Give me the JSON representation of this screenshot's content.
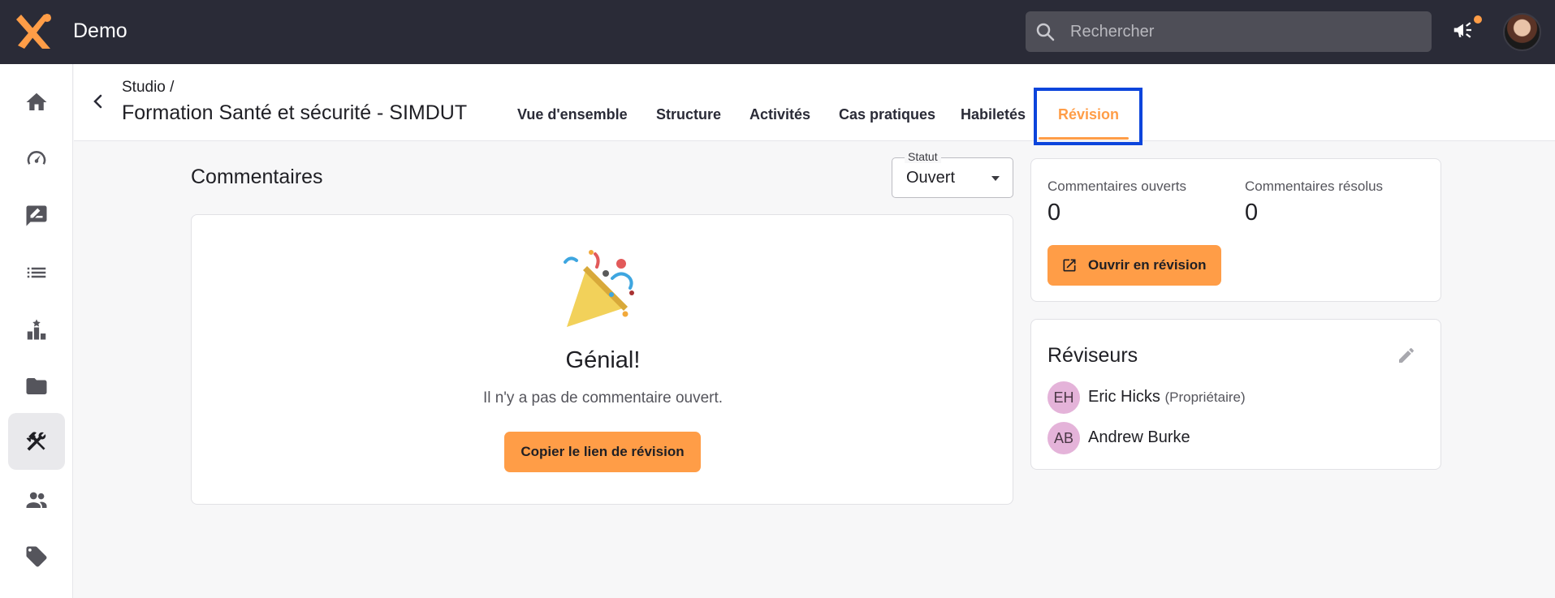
{
  "app": {
    "title": "Demo"
  },
  "search": {
    "placeholder": "Rechercher"
  },
  "colors": {
    "accent": "#ff9d47",
    "topbar": "#2a2b37",
    "highlight": "#0c45dc"
  },
  "sidebar": {
    "items": [
      {
        "icon": "home-icon"
      },
      {
        "icon": "dashboard-gauge-icon"
      },
      {
        "icon": "rate-review-icon"
      },
      {
        "icon": "list-icon"
      },
      {
        "icon": "leaderboard-icon"
      },
      {
        "icon": "folder-icon"
      },
      {
        "icon": "tools-icon",
        "active": true
      },
      {
        "icon": "people-icon"
      },
      {
        "icon": "tag-icon"
      }
    ]
  },
  "header": {
    "breadcrumb": "Studio /",
    "title": "Formation Santé et sécurité - SIMDUT",
    "tabs": [
      {
        "label": "Vue d'ensemble"
      },
      {
        "label": "Structure"
      },
      {
        "label": "Activités"
      },
      {
        "label": "Cas pratiques"
      },
      {
        "label": "Habiletés"
      },
      {
        "label": "Révision",
        "active": true
      }
    ]
  },
  "comments": {
    "title": "Commentaires",
    "status": {
      "legend": "Statut",
      "value": "Ouvert"
    },
    "empty": {
      "title": "Génial!",
      "subtitle": "Il n'y a pas de commentaire ouvert.",
      "button": "Copier le lien de révision"
    }
  },
  "stats": {
    "open_label": "Commentaires ouverts",
    "open_value": "0",
    "resolved_label": "Commentaires résolus",
    "resolved_value": "0",
    "open_button": "Ouvrir en révision"
  },
  "reviewers": {
    "title": "Réviseurs",
    "list": [
      {
        "initials": "EH",
        "name": "Eric Hicks",
        "role": "(Propriétaire)"
      },
      {
        "initials": "AB",
        "name": "Andrew Burke",
        "role": ""
      }
    ]
  }
}
